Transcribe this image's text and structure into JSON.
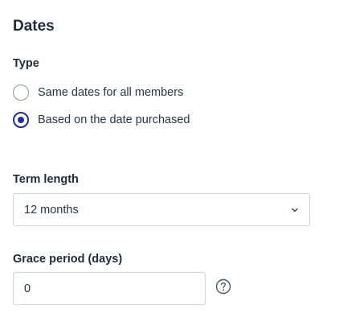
{
  "section": {
    "title": "Dates"
  },
  "type": {
    "label": "Type",
    "options": [
      {
        "label": "Same dates for all members",
        "checked": false
      },
      {
        "label": "Based on the date purchased",
        "checked": true
      }
    ]
  },
  "term_length": {
    "label": "Term length",
    "selected": "12 months",
    "icon": "chevron-down-icon"
  },
  "grace_period": {
    "label": "Grace period (days)",
    "value": "0",
    "help_icon": "help-circle-icon"
  },
  "colors": {
    "accent": "#1d2fa3",
    "text": "#1f2a3a",
    "border": "#cfd4da"
  }
}
